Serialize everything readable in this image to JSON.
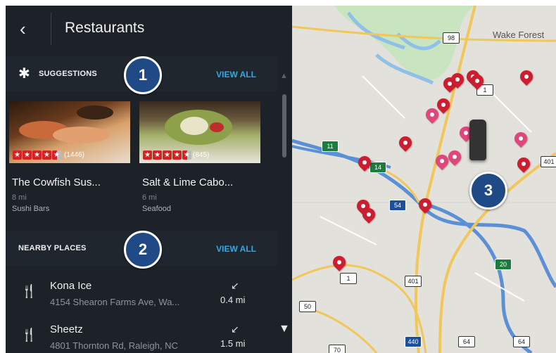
{
  "header": {
    "back_icon": "chevron-left-icon",
    "title": "Restaurants"
  },
  "suggestions": {
    "title": "SUGGESTIONS",
    "view_all": "VIEW ALL",
    "badge": "1",
    "cards": [
      {
        "name": "The Cowfish Sus...",
        "distance": "8 mi",
        "category": "Sushi Bars",
        "reviews": "(1446)",
        "rating": 4.5
      },
      {
        "name": "Salt & Lime Cabo...",
        "distance": "6 mi",
        "category": "Seafood",
        "reviews": "(845)",
        "rating": 4.5
      }
    ]
  },
  "nearby": {
    "title": "NEARBY PLACES",
    "view_all": "VIEW ALL",
    "badge": "2",
    "items": [
      {
        "name": "Kona Ice",
        "address": "4154 Shearon Farms Ave, Wa...",
        "arrow": "↙",
        "distance": "0.4 mi"
      },
      {
        "name": "Sheetz",
        "address": "4801 Thornton Rd, Raleigh, NC",
        "arrow": "↙",
        "distance": "1.5 mi"
      }
    ]
  },
  "map": {
    "badge": "3",
    "place_label": "Wake Forest",
    "shields": [
      "98",
      "1",
      "11",
      "401",
      "54",
      "14",
      "401",
      "1",
      "20",
      "50",
      "440",
      "64",
      "64",
      "70"
    ]
  },
  "colors": {
    "panel_bg": "#1d2229",
    "accent": "#2ea8e6",
    "yelp_red": "#d32323",
    "badge_blue": "#1f4a86"
  }
}
